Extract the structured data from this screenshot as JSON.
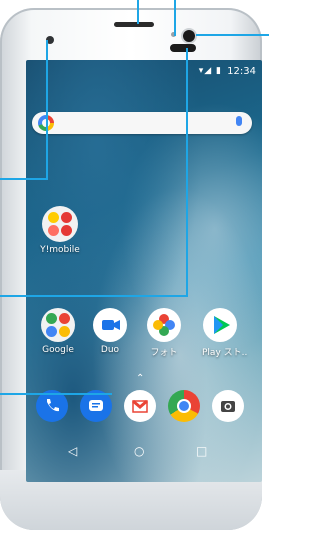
{
  "status": {
    "time": "12:34",
    "icons": "▾◢ ▮"
  },
  "folders": {
    "ymobile_label": "Y!mobile",
    "google_label": "Google"
  },
  "apps": [
    {
      "label": "Duo",
      "color": "#ffffff",
      "icon": "video-icon"
    },
    {
      "label": "フォト",
      "color": "#ffffff",
      "icon": "pinwheel-icon"
    },
    {
      "label": "Play スト..",
      "color": "#ffffff",
      "icon": "play-icon"
    }
  ],
  "dock_icons": [
    "phone-icon",
    "messages-icon",
    "gmail-icon",
    "chrome-icon",
    "camera-icon"
  ],
  "nav": {
    "back": "◁",
    "home": "○",
    "recent": "□"
  },
  "chevron": "⌃",
  "accent": "#1ea6e6"
}
